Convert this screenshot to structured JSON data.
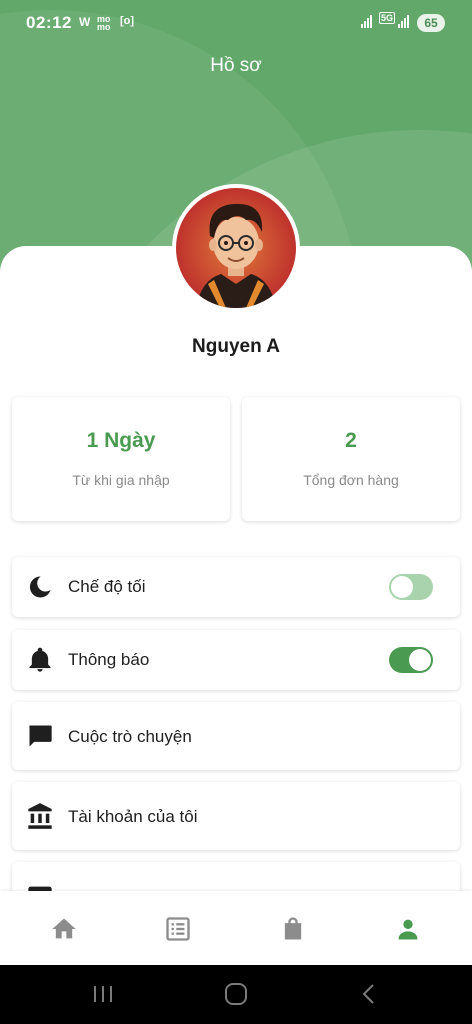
{
  "status_bar": {
    "time": "02:12",
    "notification_icons": [
      "W",
      "mo mo",
      "[o]"
    ],
    "network": "5G",
    "battery": "65"
  },
  "header": {
    "title": "Hồ sơ"
  },
  "profile": {
    "name": "Nguyen A",
    "avatar": "cartoon-avatar-with-glasses"
  },
  "stats": [
    {
      "value": "1 Ngày",
      "label": "Từ khi gia nhập"
    },
    {
      "value": "2",
      "label": "Tổng đơn hàng"
    }
  ],
  "menu": [
    {
      "label": "Chế độ tối",
      "icon": "moon-icon",
      "toggle": false
    },
    {
      "label": "Thông báo",
      "icon": "bell-icon",
      "toggle": true
    },
    {
      "label": "Cuộc trò chuyện",
      "icon": "chat-icon"
    },
    {
      "label": "Tài khoản của tôi",
      "icon": "bank-icon"
    }
  ],
  "bottom_nav": [
    {
      "name": "home",
      "icon": "home-icon",
      "active": false
    },
    {
      "name": "orders",
      "icon": "list-icon",
      "active": false
    },
    {
      "name": "shop",
      "icon": "shopping-bag-icon",
      "active": false
    },
    {
      "name": "profile",
      "icon": "person-icon",
      "active": true
    }
  ],
  "colors": {
    "accent": "#4a9a52",
    "header": "#62a86a",
    "toggle_off": "#a9d3ac"
  }
}
